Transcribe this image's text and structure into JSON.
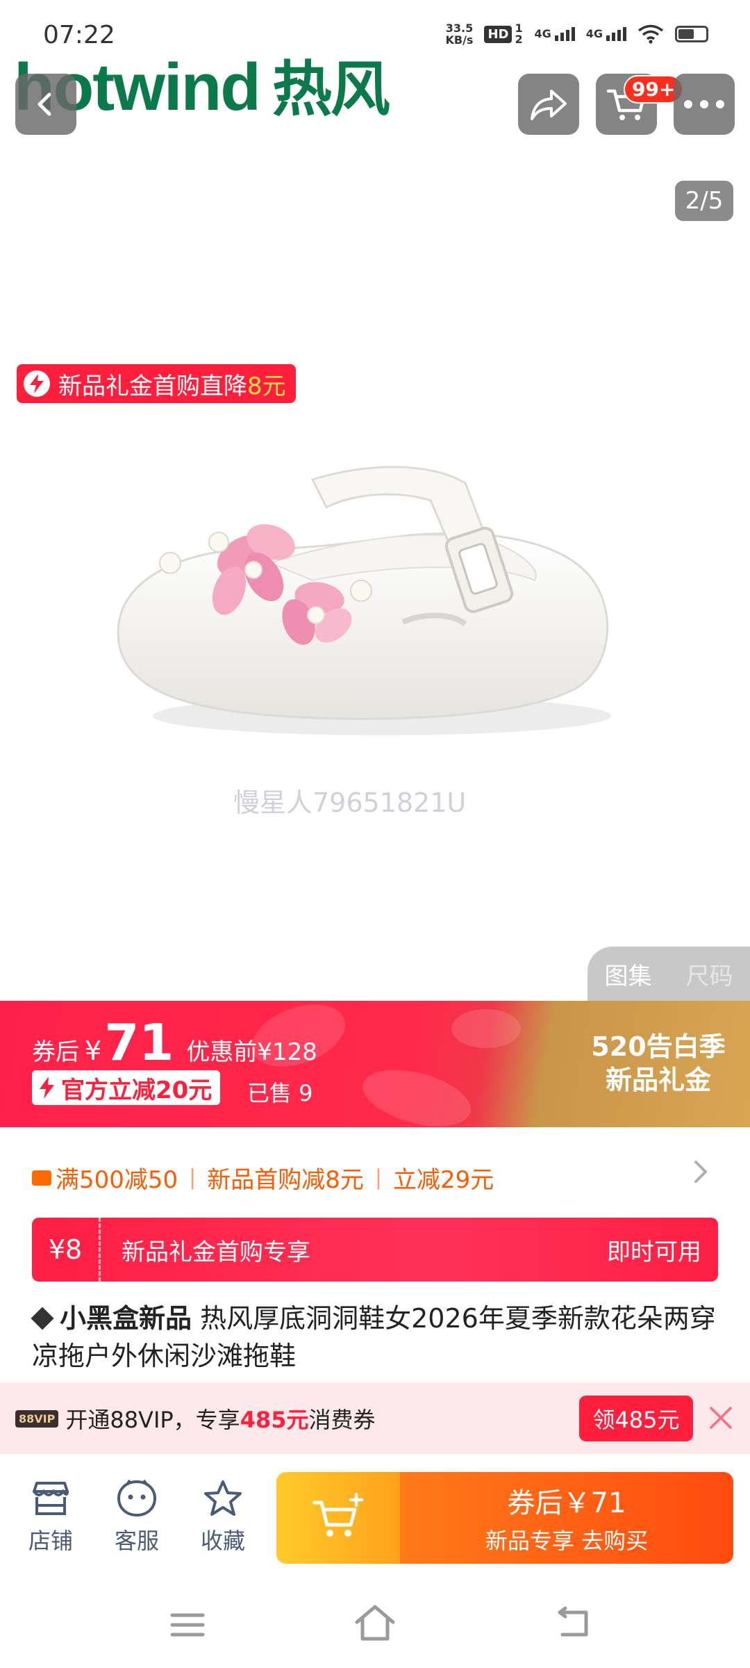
{
  "status_bar": {
    "time": "07:22",
    "net_speed_value": "33.5",
    "net_speed_unit": "KB/s",
    "hd_label": "HD",
    "hd_index": "1 2",
    "signal1_label": "4G",
    "signal2_label": "4G",
    "icons": [
      "hd-icon",
      "signal-icon",
      "signal-icon",
      "wifi-icon",
      "battery-icon"
    ]
  },
  "brand": {
    "logo_text": "hotwind",
    "logo_cn": "热风"
  },
  "header": {
    "cart_badge": "99+",
    "icons": [
      "back-arrow-icon",
      "share-icon",
      "cart-icon",
      "more-dots-icon"
    ]
  },
  "gallery": {
    "counter": "2/5",
    "watermark": "慢星人79651821U",
    "promo_tag_text": "新品礼金首购直降",
    "promo_tag_amount": "8元",
    "tabs": [
      "图集",
      "尺码"
    ]
  },
  "price": {
    "prefix": "券后",
    "currency": "¥",
    "value": "71",
    "original": "优惠前¥128",
    "official_cut": "官方立减20元",
    "sold": "已售 9",
    "campaign_line1": "520告白季",
    "campaign_line2": "新品礼金"
  },
  "coupons": {
    "items": [
      "满500减50",
      "新品首购减8元",
      "立减29元"
    ]
  },
  "voucher": {
    "amount": "¥8",
    "desc": "新品礼金首购专享",
    "action": "即时可用"
  },
  "product": {
    "tag": "小黑盒新品",
    "title": "热风厚底洞洞鞋女2026年夏季新款花朵两穿凉拖户外休闲沙滩拖鞋"
  },
  "vip": {
    "logo": "88VIP",
    "text_prefix": "开通88VIP，专享",
    "amount": "485元",
    "text_suffix": "消费券",
    "button": "领485元"
  },
  "bottom_bar": {
    "shop": "店铺",
    "service": "客服",
    "favorite": "收藏",
    "buy_line1": "券后￥71",
    "buy_line2": "新品专享 去购买"
  },
  "colors": {
    "primary_red": "#ff1f3d",
    "brand_green": "#0b7a4b",
    "coupon_orange": "#ff5a00",
    "buy_orange": "#ff5a12"
  }
}
